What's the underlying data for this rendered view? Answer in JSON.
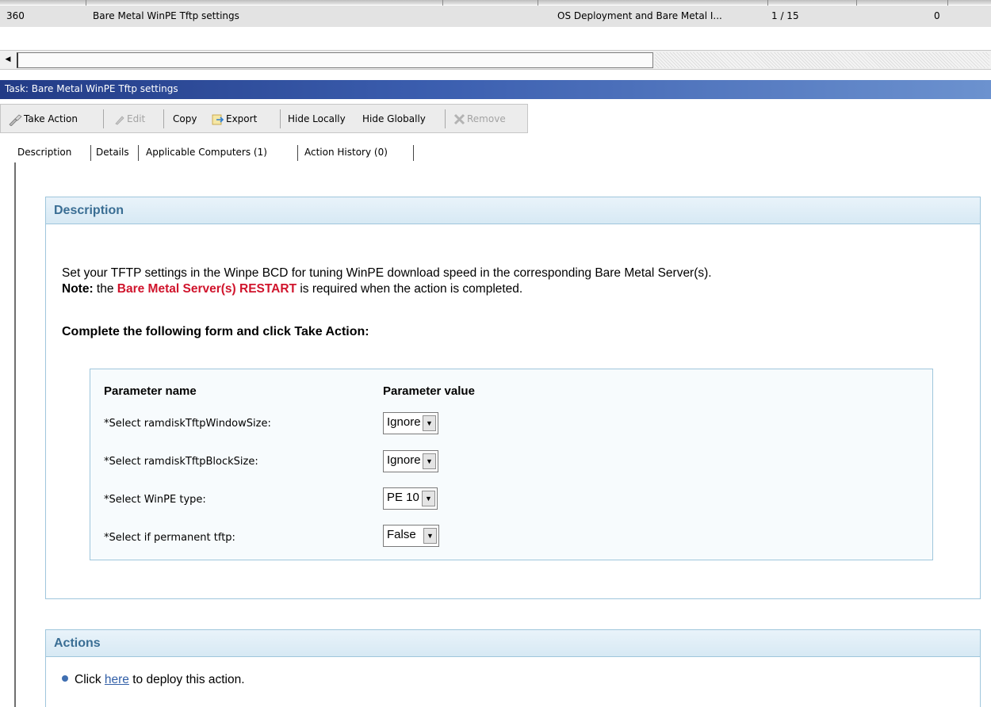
{
  "list_row": {
    "id": "360",
    "name": "Bare Metal WinPE Tftp settings",
    "site": "OS Deployment and Bare Metal I...",
    "applicable": "1 / 15",
    "count": "0"
  },
  "scrollbar": {
    "left_arrow": "◀"
  },
  "task_title": "Task: Bare Metal WinPE Tftp settings",
  "toolbar": {
    "take_action": "Take Action",
    "edit": "Edit",
    "copy": "Copy",
    "export": "Export",
    "hide_locally": "Hide Locally",
    "hide_globally": "Hide Globally",
    "remove": "Remove"
  },
  "tabs": [
    {
      "label": "Description",
      "active": true
    },
    {
      "label": "Details"
    },
    {
      "label": "Applicable Computers (1)"
    },
    {
      "label": "Action History (0)"
    }
  ],
  "description": {
    "header": "Description",
    "line1": "Set your TFTP settings in the Winpe BCD for tuning WinPE download speed in the corresponding Bare Metal Server(s).",
    "note_label": "Note:",
    "note_pre": " the ",
    "note_red": "Bare Metal Server(s) RESTART",
    "note_post": " is required when the action is completed.",
    "form_heading": "Complete the following form and click Take Action:"
  },
  "params": {
    "col_name": "Parameter name",
    "col_value": "Parameter value",
    "rows": [
      {
        "label": "*Select ramdiskTftpWindowSize:",
        "value": "Ignore"
      },
      {
        "label": "*Select ramdiskTftpBlockSize:",
        "value": "Ignore"
      },
      {
        "label": "*Select WinPE type:",
        "value": "PE 10"
      },
      {
        "label": "*Select if permanent tftp:",
        "value": "False"
      }
    ]
  },
  "actions": {
    "header": "Actions",
    "text_pre": "Click ",
    "link": "here",
    "text_post": " to deploy this action."
  },
  "colors": {
    "title_bar": "#223b86",
    "section_header_text": "#3a6e94",
    "section_border": "#9fc6dc",
    "note_red": "#d0142c",
    "link": "#3360a8"
  }
}
